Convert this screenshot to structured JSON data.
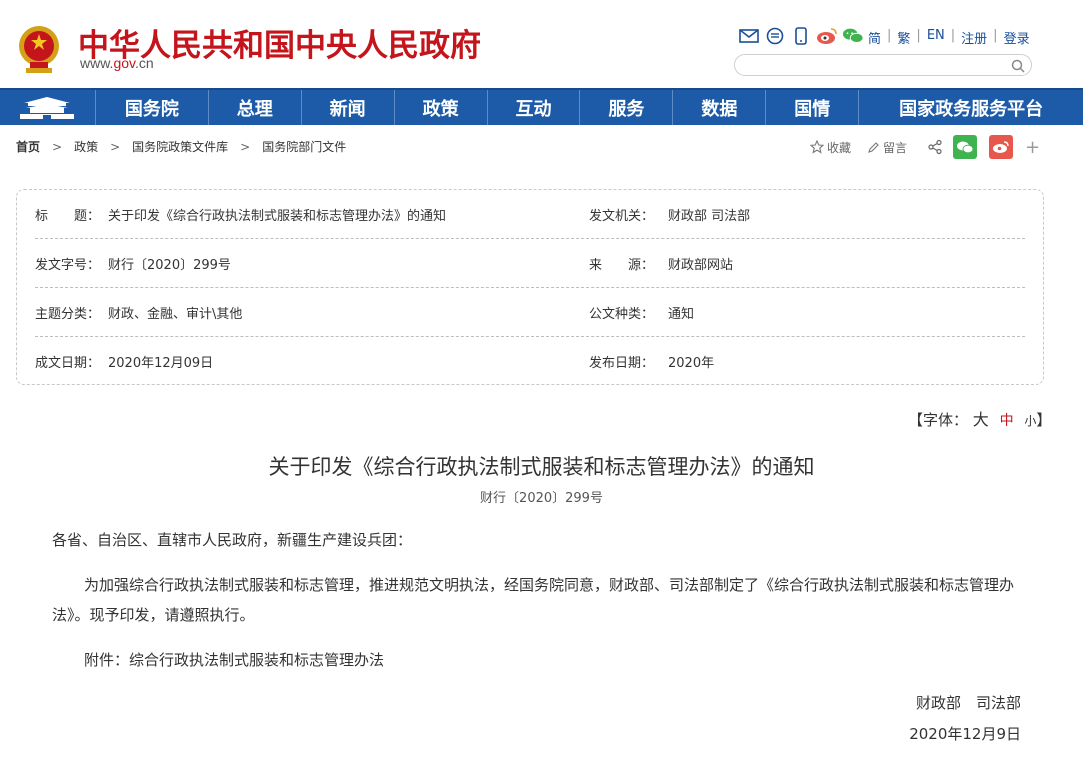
{
  "header": {
    "site_title": "中华人民共和国中央人民政府",
    "site_url_prefix": "www.",
    "site_url_mid": "gov",
    "site_url_suffix": ".cn",
    "tools": [
      "email-icon",
      "chat-icon",
      "mobile-icon",
      "weibo-icon",
      "wechat-icon"
    ],
    "lang": {
      "simplified": "简",
      "traditional": "繁",
      "english": "EN",
      "register": "注册",
      "login": "登录",
      "sep": "|"
    },
    "search_placeholder": ""
  },
  "nav": {
    "items": [
      "国务院",
      "总理",
      "新闻",
      "政策",
      "互动",
      "服务",
      "数据",
      "国情",
      "国家政务服务平台"
    ]
  },
  "breadcrumb": {
    "items": [
      "首页",
      "政策",
      "国务院政策文件库",
      "国务院部门文件"
    ],
    "sep": ">"
  },
  "share": {
    "favorite": "收藏",
    "comment": "留言",
    "plus": "+"
  },
  "info": {
    "title_label": "标　　题：",
    "title_value": "关于印发《综合行政执法制式服装和标志管理办法》的通知",
    "issuer_label": "发文机关：",
    "issuer_value": "财政部 司法部",
    "docno_label": "发文字号：",
    "docno_value": "财行〔2020〕299号",
    "source_label": "来　　源：",
    "source_value": "财政部网站",
    "topic_label": "主题分类：",
    "topic_value": "财政、金融、审计\\其他",
    "kind_label": "公文种类：",
    "kind_value": "通知",
    "written_label": "成文日期：",
    "written_value": "2020年12月09日",
    "published_label": "发布日期：",
    "published_value": "2020年"
  },
  "font_size": {
    "prefix": "【字体：",
    "big": "大",
    "mid": "中",
    "small": "小",
    "suffix": "】"
  },
  "doc": {
    "title": "关于印发《综合行政执法制式服装和标志管理办法》的通知",
    "number": "财行〔2020〕299号",
    "salutation": "各省、自治区、直辖市人民政府，新疆生产建设兵团：",
    "para1": "为加强综合行政执法制式服装和标志管理，推进规范文明执法，经国务院同意，财政部、司法部制定了《综合行政执法制式服装和标志管理办法》。现予印发，请遵照执行。",
    "attachment": "附件：综合行政执法制式服装和标志管理办法",
    "signer": "财政部　司法部",
    "date": "2020年12月9日"
  },
  "colors": {
    "brand_red": "#c3151b",
    "nav_blue": "#1d5ba8",
    "wechat_green": "#3fb34f",
    "weibo_red": "#e8574e"
  }
}
